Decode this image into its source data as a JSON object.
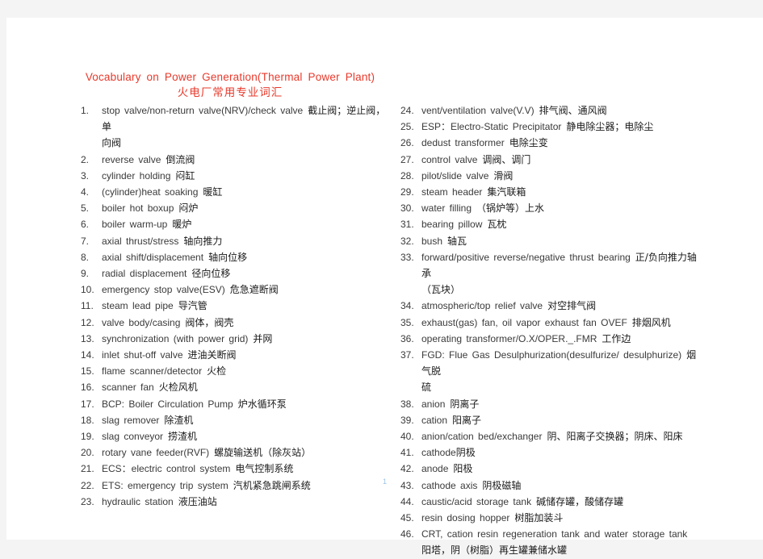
{
  "document": {
    "title_en": "Vocabulary on Power Generation(Thermal Power Plant)",
    "title_cn": "火电厂常用专业词汇",
    "page_number": "1",
    "title_color": "#e8392b"
  },
  "left_column": [
    {
      "num": "1.",
      "en": "stop valve/non-return valve(NRV)/check valve",
      "cn": "截止阀；逆止阀，单",
      "cn_wrap": "向阀"
    },
    {
      "num": "2.",
      "en": "reverse valve",
      "cn": "倒流阀"
    },
    {
      "num": "3.",
      "en": "cylinder holding",
      "cn": "闷缸"
    },
    {
      "num": "4.",
      "en": "(cylinder)heat soaking",
      "cn": "暖缸"
    },
    {
      "num": "5.",
      "en": "boiler hot boxup",
      "cn": "闷炉"
    },
    {
      "num": "6.",
      "en": "boiler warm-up",
      "cn": "暖炉"
    },
    {
      "num": "7.",
      "en": "axial thrust/stress",
      "cn": "轴向推力"
    },
    {
      "num": "8.",
      "en": "axial shift/displacement",
      "cn": "轴向位移"
    },
    {
      "num": "9.",
      "en": "radial displacement",
      "cn": "径向位移"
    },
    {
      "num": "10.",
      "en": "emergency stop valve(ESV)",
      "cn": "危急遮断阀"
    },
    {
      "num": "11.",
      "en": "steam lead pipe",
      "cn": "导汽管"
    },
    {
      "num": "12.",
      "en": "valve body/casing",
      "cn": "阀体，阀壳"
    },
    {
      "num": "13.",
      "en": "synchronization (with power grid)",
      "cn": "并网"
    },
    {
      "num": "14.",
      "en": "inlet shut-off valve",
      "cn": "进油关断阀"
    },
    {
      "num": "15.",
      "en": "flame scanner/detector",
      "cn": "火检"
    },
    {
      "num": "16.",
      "en": "scanner fan",
      "cn": "火检风机"
    },
    {
      "num": "17.",
      "en": "BCP: Boiler Circulation Pump",
      "cn": "炉水循环泵"
    },
    {
      "num": "18.",
      "en": "slag remover",
      "cn": "除渣机"
    },
    {
      "num": "19.",
      "en": "slag conveyor",
      "cn": "捞渣机"
    },
    {
      "num": "20.",
      "en": "rotary vane feeder(RVF)",
      "cn": "螺旋输送机（除灰站）"
    },
    {
      "num": "21.",
      "en": "ECS：electric control system",
      "cn": "电气控制系统"
    },
    {
      "num": "22.",
      "en": "ETS: emergency trip system",
      "cn": "汽机紧急跳闸系统"
    },
    {
      "num": "23.",
      "en": "hydraulic station",
      "cn": "液压油站"
    }
  ],
  "right_column": [
    {
      "num": "24.",
      "en": "vent/ventilation valve(V.V)",
      "cn": "排气阀、通风阀"
    },
    {
      "num": "25.",
      "en": "ESP：Electro-Static Precipitator",
      "cn": "静电除尘器；电除尘"
    },
    {
      "num": "26.",
      "en": "dedust transformer",
      "cn": "电除尘变"
    },
    {
      "num": "27.",
      "en": "control valve",
      "cn": "调阀、调门"
    },
    {
      "num": "28.",
      "en": "pilot/slide valve",
      "cn": "滑阀"
    },
    {
      "num": "29.",
      "en": "steam header",
      "cn": "集汽联箱"
    },
    {
      "num": "30.",
      "en": "water filling",
      "cn": "（锅炉等）上水"
    },
    {
      "num": "31.",
      "en": "bearing pillow",
      "cn": "瓦枕"
    },
    {
      "num": "32.",
      "en": "bush",
      "cn": "轴瓦"
    },
    {
      "num": "33.",
      "en": "forward/positive reverse/negative thrust bearing",
      "cn": "正/负向推力轴承",
      "cn_wrap": "（瓦块）"
    },
    {
      "num": "34.",
      "en": "atmospheric/top relief valve",
      "cn": "对空排气阀"
    },
    {
      "num": "35.",
      "en": "exhaust(gas) fan, oil vapor exhaust fan OVEF",
      "cn": "排烟风机"
    },
    {
      "num": "36.",
      "en": "operating transformer/O.X/OPER._.FMR",
      "cn": "工作边"
    },
    {
      "num": "37.",
      "en": "FGD: Flue Gas Desulphurization(desulfurize/ desulphurize)",
      "cn": "烟气脱",
      "cn_wrap": "硫"
    },
    {
      "num": "38.",
      "en": "anion",
      "cn": "阴离子"
    },
    {
      "num": "39.",
      "en": "cation",
      "cn": "阳离子"
    },
    {
      "num": "40.",
      "en": "anion/cation bed/exchanger",
      "cn": "阴、阳离子交换器；阴床、阳床"
    },
    {
      "num": "41.",
      "en": "cathode",
      "cn": "阴极",
      "nogap": true
    },
    {
      "num": "42.",
      "en": "anode",
      "cn": "阳极"
    },
    {
      "num": "43.",
      "en": "cathode axis",
      "cn": "阴极磁轴"
    },
    {
      "num": "44.",
      "en": "caustic/acid storage tank",
      "cn": "碱储存罐，酸储存罐"
    },
    {
      "num": "45.",
      "en": "resin dosing hopper",
      "cn": "树脂加装斗"
    },
    {
      "num": "46.",
      "en": "CRT, cation resin regeneration tank and water storage tank",
      "cn": "",
      "cn_wrap": "阳塔，阴（树脂）再生罐兼储水罐"
    }
  ]
}
